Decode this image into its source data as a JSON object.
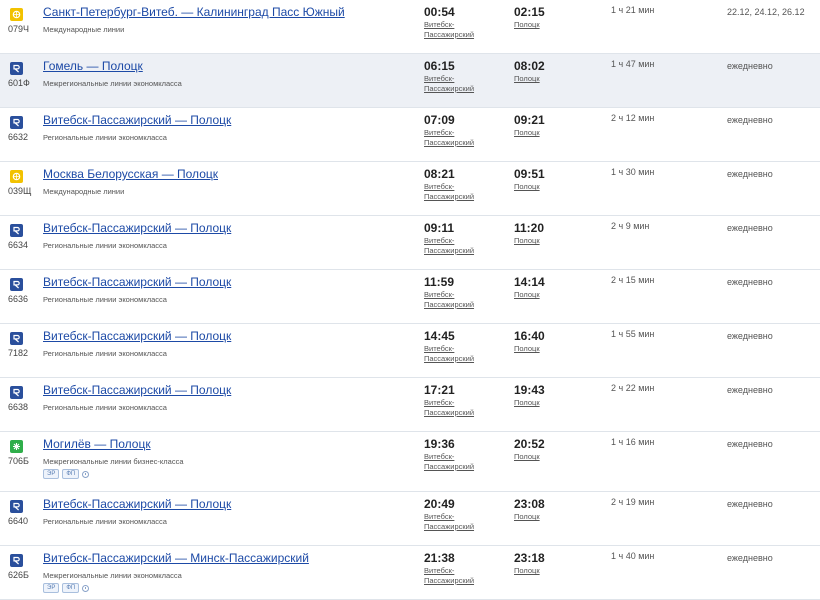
{
  "colors": {
    "link": "#1d4aa6",
    "row_shade": "#edf0f5",
    "international_icon": "#f2c200",
    "regional_icon": "#2a4f9c",
    "business_icon": "#2fae4a"
  },
  "trains": [
    {
      "icon": "international-train-icon",
      "number": "079Ч",
      "route": "Санкт-Петербург-Витеб. — Калининград Пасс Южный",
      "type": "Международные линии",
      "departure": "00:54",
      "departure_station": "Витебск-Пассажирский",
      "arrival": "02:15",
      "arrival_station": "Полоцк",
      "duration": "1 ч 21 мин",
      "days": "22.12, 24.12, 26.12"
    },
    {
      "icon": "interregional-train-icon",
      "number": "601Ф",
      "route": "Гомель — Полоцк",
      "type": "Межрегиональные линии экономкласса",
      "departure": "06:15",
      "departure_station": "Витебск-Пассажирский",
      "arrival": "08:02",
      "arrival_station": "Полоцк",
      "duration": "1 ч 47 мин",
      "days": "ежедневно"
    },
    {
      "icon": "regional-train-icon",
      "number": "6632",
      "route": "Витебск-Пассажирский — Полоцк",
      "type": "Региональные линии экономкласса",
      "departure": "07:09",
      "departure_station": "Витебск-Пассажирский",
      "arrival": "09:21",
      "arrival_station": "Полоцк",
      "duration": "2 ч 12 мин",
      "days": "ежедневно"
    },
    {
      "icon": "international-train-icon",
      "number": "039Щ",
      "route": "Москва Белорусская — Полоцк",
      "type": "Международные линии",
      "departure": "08:21",
      "departure_station": "Витебск-Пассажирский",
      "arrival": "09:51",
      "arrival_station": "Полоцк",
      "duration": "1 ч 30 мин",
      "days": "ежедневно"
    },
    {
      "icon": "regional-train-icon",
      "number": "6634",
      "route": "Витебск-Пассажирский — Полоцк",
      "type": "Региональные линии экономкласса",
      "departure": "09:11",
      "departure_station": "Витебск-Пассажирский",
      "arrival": "11:20",
      "arrival_station": "Полоцк",
      "duration": "2 ч 9 мин",
      "days": "ежедневно"
    },
    {
      "icon": "regional-train-icon",
      "number": "6636",
      "route": "Витебск-Пассажирский — Полоцк",
      "type": "Региональные линии экономкласса",
      "departure": "11:59",
      "departure_station": "Витебск-Пассажирский",
      "arrival": "14:14",
      "arrival_station": "Полоцк",
      "duration": "2 ч 15 мин",
      "days": "ежедневно"
    },
    {
      "icon": "regional-train-icon",
      "number": "7182",
      "route": "Витебск-Пассажирский — Полоцк",
      "type": "Региональные линии экономкласса",
      "departure": "14:45",
      "departure_station": "Витебск-Пассажирский",
      "arrival": "16:40",
      "arrival_station": "Полоцк",
      "duration": "1 ч 55 мин",
      "days": "ежедневно"
    },
    {
      "icon": "regional-train-icon",
      "number": "6638",
      "route": "Витебск-Пассажирский — Полоцк",
      "type": "Региональные линии экономкласса",
      "departure": "17:21",
      "departure_station": "Витебск-Пассажирский",
      "arrival": "19:43",
      "arrival_station": "Полоцк",
      "duration": "2 ч 22 мин",
      "days": "ежедневно"
    },
    {
      "icon": "business-train-icon",
      "number": "706Б",
      "route": "Могилёв — Полоцк",
      "type": "Межрегиональные линии бизнес-класса",
      "badges": [
        "ЭР",
        "ФП"
      ],
      "departure": "19:36",
      "departure_station": "Витебск-Пассажирский",
      "arrival": "20:52",
      "arrival_station": "Полоцк",
      "duration": "1 ч 16 мин",
      "days": "ежедневно"
    },
    {
      "icon": "regional-train-icon",
      "number": "6640",
      "route": "Витебск-Пассажирский — Полоцк",
      "type": "Региональные линии экономкласса",
      "departure": "20:49",
      "departure_station": "Витебск-Пассажирский",
      "arrival": "23:08",
      "arrival_station": "Полоцк",
      "duration": "2 ч 19 мин",
      "days": "ежедневно"
    },
    {
      "icon": "interregional-train-icon",
      "number": "626Б",
      "route": "Витебск-Пассажирский — Минск-Пассажирский",
      "type": "Межрегиональные линии экономкласса",
      "badges": [
        "ЭР",
        "ФП"
      ],
      "departure": "21:38",
      "departure_station": "Витебск-Пассажирский",
      "arrival": "23:18",
      "arrival_station": "Полоцк",
      "duration": "1 ч 40 мин",
      "days": "ежедневно"
    }
  ]
}
